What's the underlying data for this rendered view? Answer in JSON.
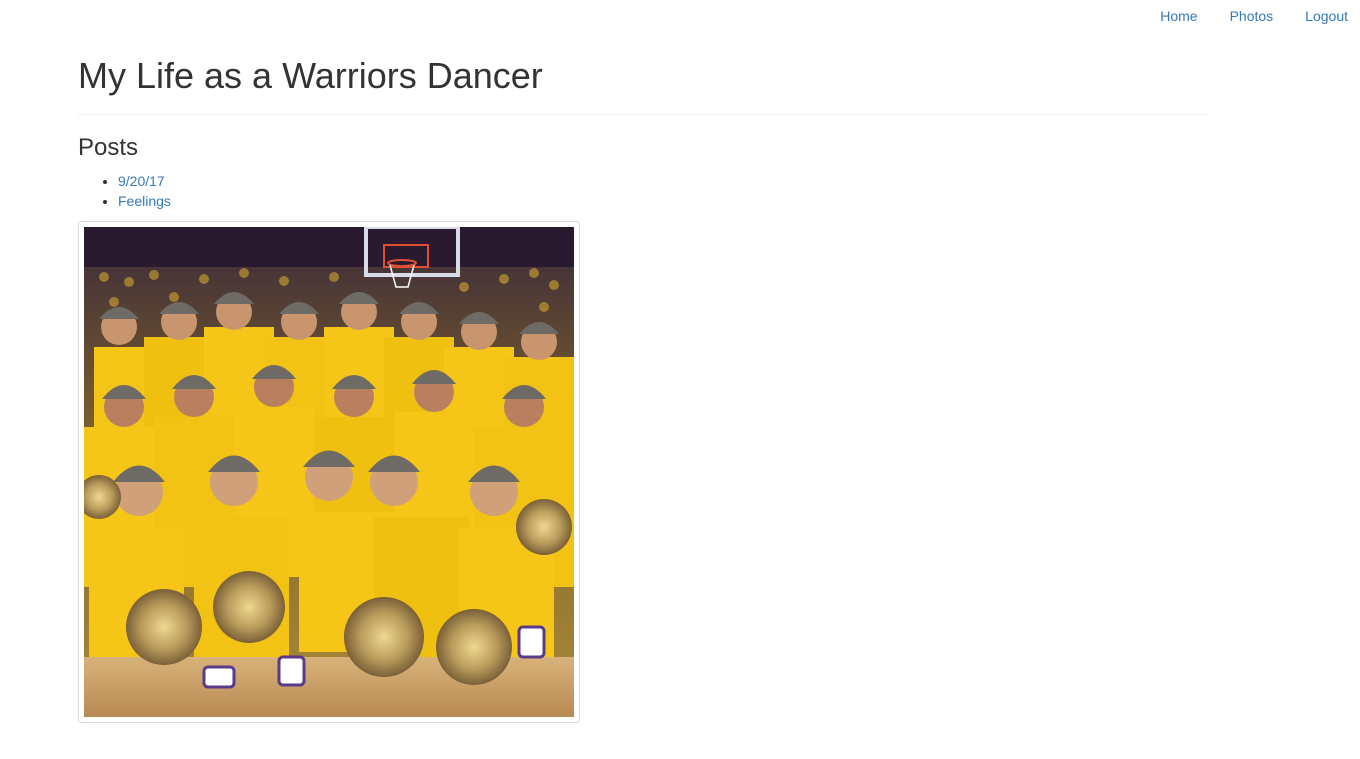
{
  "nav": {
    "home": "Home",
    "photos": "Photos",
    "logout": "Logout"
  },
  "page": {
    "title": "My Life as a Warriors Dancer",
    "posts_heading": "Posts"
  },
  "posts": [
    {
      "label": "9/20/17"
    },
    {
      "label": "Feelings"
    }
  ],
  "photo": {
    "description_icon": "team-photo-image"
  },
  "colors": {
    "link": "#337ab7",
    "text": "#333333",
    "jersey_yellow": "#f5c518",
    "cap_gray": "#6e6a66",
    "court_wood": "#c89a5c"
  }
}
